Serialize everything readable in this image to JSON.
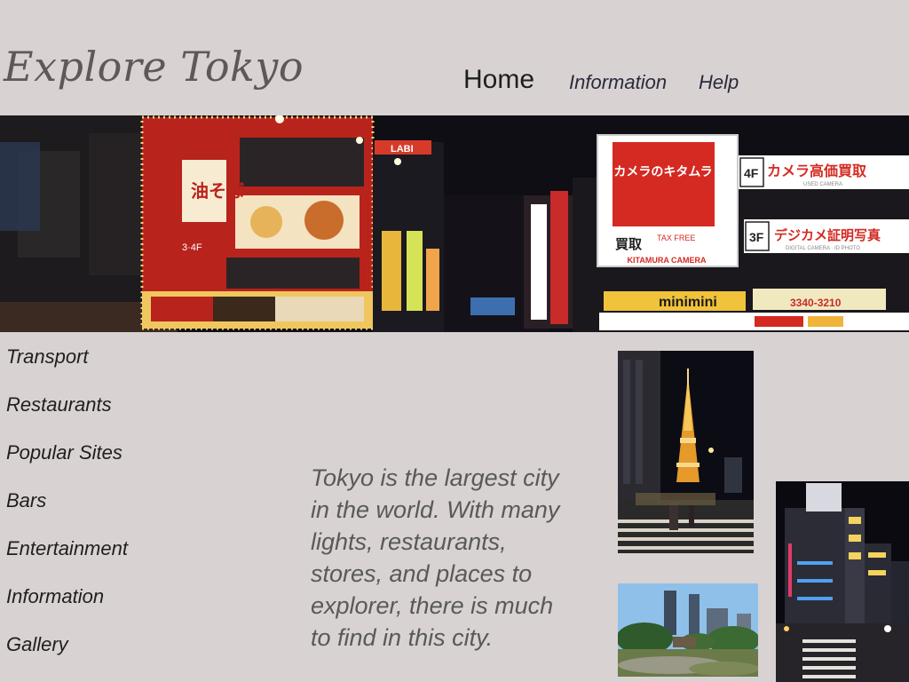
{
  "header": {
    "title": "Explore Tokyo"
  },
  "top_nav": {
    "home": "Home",
    "information": "Information",
    "help": "Help"
  },
  "banner": {
    "signs": {
      "store": "カメラのキタムラ",
      "tax_free": "TAX FREE",
      "kaitori": "買取",
      "store_en": "KITAMURA CAMERA",
      "used_camera": "カメラ高価買取",
      "used_camera_en": "USED CAMERA",
      "floor_4": "4F",
      "floor_3": "3F",
      "digital_photo": "デジカメ証明写真",
      "digital_photo_en": "DIGITAL CAMERA · ID PHOTO",
      "minimini": "minimini",
      "minimini_phone": "3340-3210",
      "lab": "LABI",
      "noodle": "油そば",
      "floor_34": "3·4F"
    }
  },
  "side_nav": {
    "items": [
      "Transport",
      "Restaurants",
      "Popular Sites",
      "Bars",
      "Entertainment",
      "Information",
      "Gallery"
    ]
  },
  "main": {
    "intro_lines": [
      "Tokyo is the largest city",
      "in the world. With many",
      "lights, restaurants,",
      "stores, and places to",
      "explorer, there is much",
      "to find in this city."
    ]
  },
  "colors": {
    "page_bg": "#d9d2d2",
    "title_text": "#5e5857",
    "body_text": "#595959",
    "nav_text": "#1e1e1e",
    "sign_red": "#d42a22"
  }
}
